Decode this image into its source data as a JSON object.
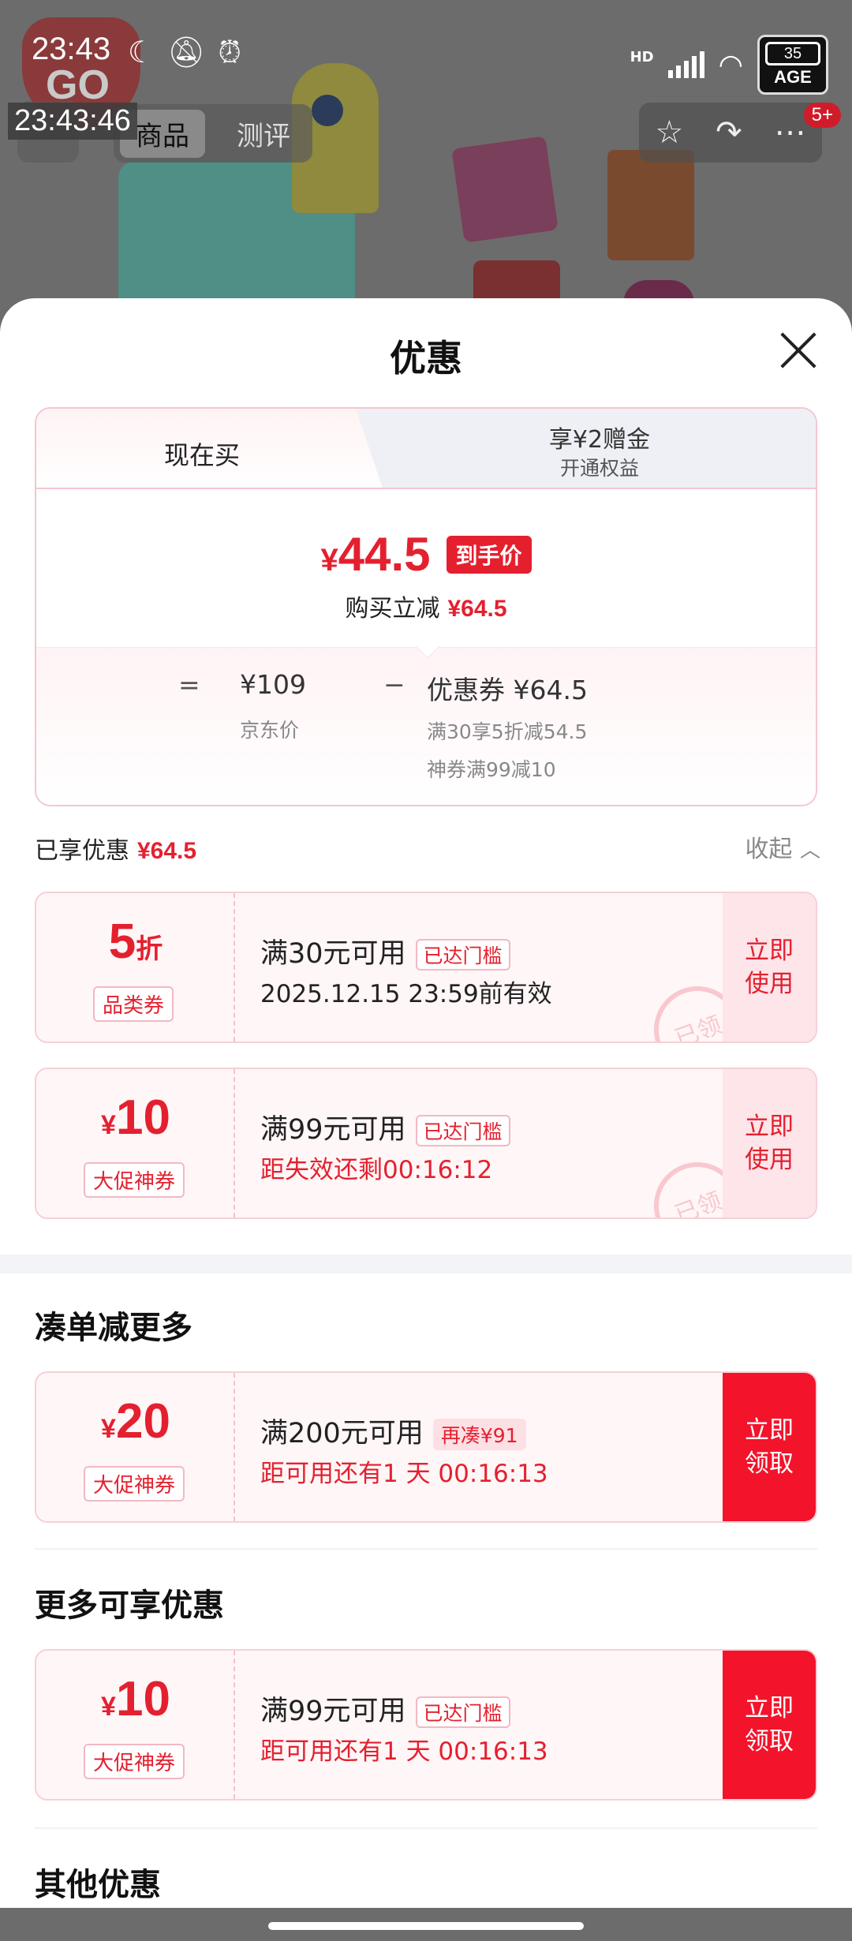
{
  "status_bar": {
    "time": "23:43",
    "icons": [
      "moon-icon",
      "bell-off-icon",
      "alarm-icon"
    ],
    "network": "HD",
    "battery": "35",
    "battery_sub": "AGE"
  },
  "overlay_timestamp": "23:43:46",
  "top_nav": {
    "tabs": [
      "商品",
      "测评"
    ],
    "notification_count": "5+"
  },
  "sheet": {
    "title": "优惠",
    "price_panel": {
      "tab_now": "现在买",
      "tab_bonus": "享¥2赠金",
      "tab_bonus_sub": "开通权益",
      "currency": "¥",
      "final_price": "44.5",
      "final_price_tag": "到手价",
      "instant_cut_label": "购买立减",
      "instant_cut_value": "¥64.5",
      "calc": {
        "equals": "=",
        "original_price": "¥109",
        "original_price_label": "京东价",
        "minus": "−",
        "coupon_label": "优惠券 ¥64.5",
        "coupon_detail_1": "满30享5折减54.5",
        "coupon_detail_2": "神券满99减10"
      }
    },
    "enjoyed": {
      "label": "已享优惠",
      "value": "¥64.5",
      "collapse_label": "收起"
    },
    "enjoyed_coupons": [
      {
        "value": "5",
        "value_suffix": "折",
        "kind": "品类券",
        "condition": "满30元可用",
        "condition_tag": "已达门槛",
        "subtitle": "2025.12.15 23:59前有效",
        "action": "立即使用",
        "stamp": "已领"
      },
      {
        "value_prefix": "¥",
        "value": "10",
        "kind": "大促神券",
        "condition": "满99元可用",
        "condition_tag": "已达门槛",
        "subtitle": "距失效还剩00:16:12",
        "action": "立即使用",
        "stamp": "已领"
      }
    ],
    "section_more_orders": {
      "title": "凑单减更多",
      "coupon": {
        "value_prefix": "¥",
        "value": "20",
        "kind": "大促神券",
        "condition": "满200元可用",
        "condition_tag": "再凑¥91",
        "subtitle": "距可用还有1 天 00:16:13",
        "action": "立即领取"
      }
    },
    "section_more_offers": {
      "title": "更多可享优惠",
      "coupon": {
        "value_prefix": "¥",
        "value": "10",
        "kind": "大促神券",
        "condition": "满99元可用",
        "condition_tag": "已达门槛",
        "subtitle": "距可用还有1 天 00:16:13",
        "action": "立即领取"
      }
    },
    "section_other": {
      "title": "其他优惠"
    }
  }
}
